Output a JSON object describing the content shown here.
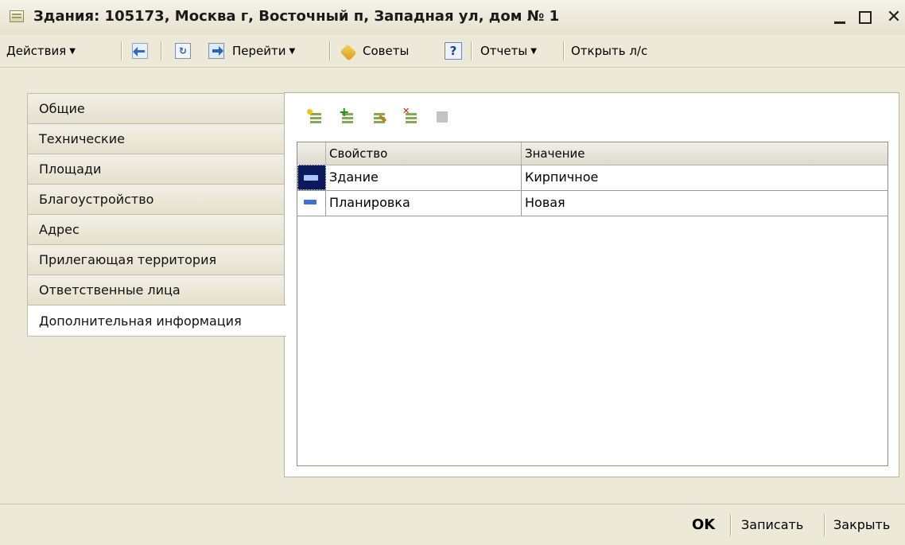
{
  "window": {
    "title": "Здания: 105173, Москва г, Восточный п, Западная ул, дом № 1",
    "minimize": "_",
    "close": "✕"
  },
  "command_bar": {
    "actions": "Действия",
    "goto": "Перейти",
    "tips": "Советы",
    "help": "?",
    "reports": "Отчеты",
    "open_account": "Открыть л/с"
  },
  "tabs": [
    {
      "label": "Общие"
    },
    {
      "label": "Технические"
    },
    {
      "label": "Площади"
    },
    {
      "label": "Благоустройство"
    },
    {
      "label": "Адрес"
    },
    {
      "label": "Прилегающая территория"
    },
    {
      "label": "Ответственные лица"
    },
    {
      "label": "Дополнительная информация",
      "active": true
    }
  ],
  "grid": {
    "columns": [
      "Свойство",
      "Значение"
    ],
    "rows": [
      {
        "property": "Здание",
        "value": "Кирпичное",
        "selected": true
      },
      {
        "property": "Планировка",
        "value": "Новая",
        "selected": false
      }
    ]
  },
  "footer": {
    "ok": "OK",
    "save": "Записать",
    "close": "Закрыть"
  },
  "colors": {
    "window_bg": "#ece9d8",
    "selection": "#0b1a5c",
    "accent": "#2d6ad0"
  }
}
